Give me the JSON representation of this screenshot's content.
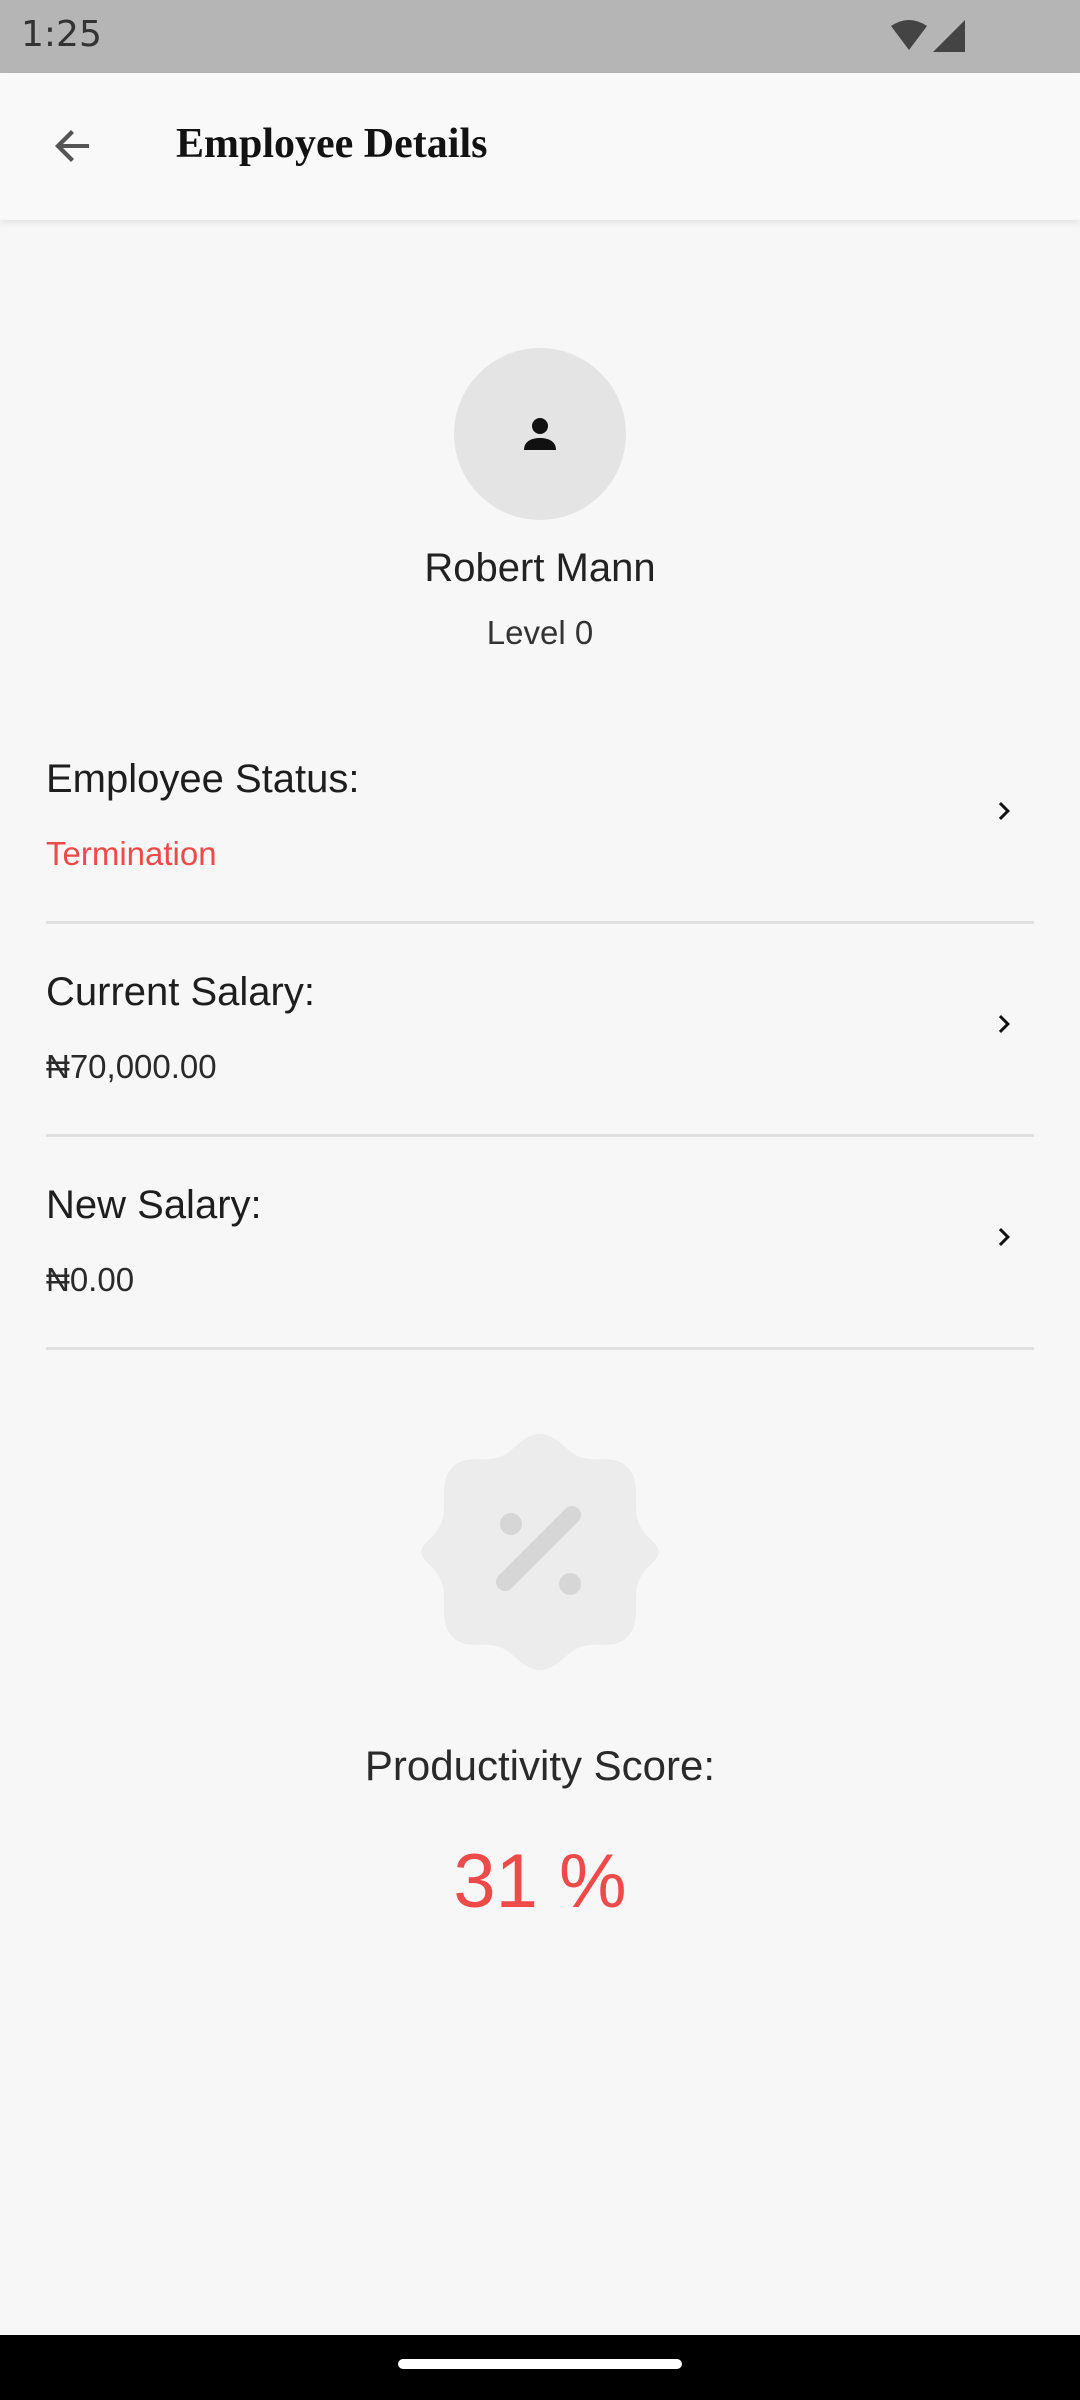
{
  "status_bar": {
    "time": "1:25",
    "icons": [
      "wifi-icon",
      "cellular-signal-icon"
    ]
  },
  "app_bar": {
    "back_icon": "arrow-back-icon",
    "title": "Employee Details"
  },
  "profile": {
    "avatar_icon": "person-icon",
    "name": "Robert Mann",
    "level": "Level 0"
  },
  "details": [
    {
      "label": "Employee Status:",
      "value": "Termination",
      "value_color": "#ee4a4a"
    },
    {
      "label": "Current Salary:",
      "value": "₦70,000.00"
    },
    {
      "label": "New Salary:",
      "value": "₦0.00"
    }
  ],
  "productivity": {
    "badge_icon": "percent-badge-icon",
    "label": "Productivity Score:",
    "value": "31 %",
    "value_color": "#ee4a4a"
  },
  "colors": {
    "accent_alert": "#ee4a4a",
    "background": "#f7f7f7",
    "status_bar": "#b5b5b5"
  }
}
